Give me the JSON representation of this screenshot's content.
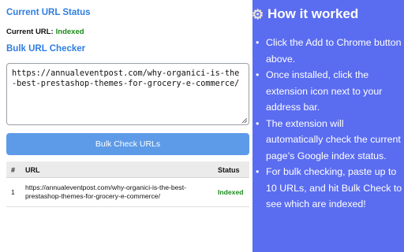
{
  "status_section": {
    "title": "Current URL Status",
    "current_label": "Current URL:",
    "current_value": "Indexed"
  },
  "bulk_section": {
    "title": "Bulk URL Checker",
    "textarea_value": "https://annualeventpost.com/why-organici-is-the-best-prestashop-themes-for-grocery-e-commerce/",
    "button_label": "Bulk Check URLs"
  },
  "table": {
    "headers": [
      "#",
      "URL",
      "Status"
    ],
    "rows": [
      {
        "num": "1",
        "url": "https://annualeventpost.com/why-organici-is-the-best-prestashop-themes-for-grocery-e-commerce/",
        "status": "Indexed"
      }
    ]
  },
  "how_it_worked": {
    "icon": "gear-icon",
    "title": "How it worked",
    "steps": [
      "Click the Add to Chrome button above.",
      "Once installed, click the extension icon next to your address bar.",
      "The extension will automatically check the current page’s Google index status.",
      "For bulk checking, paste up to 10 URLs, and hit Bulk Check to see which are indexed!"
    ]
  },
  "colors": {
    "accent_blue": "#2f7de1",
    "button_blue": "#5d9be8",
    "panel_purple": "#5a6cf0",
    "indexed_green": "#1a8a1a"
  }
}
